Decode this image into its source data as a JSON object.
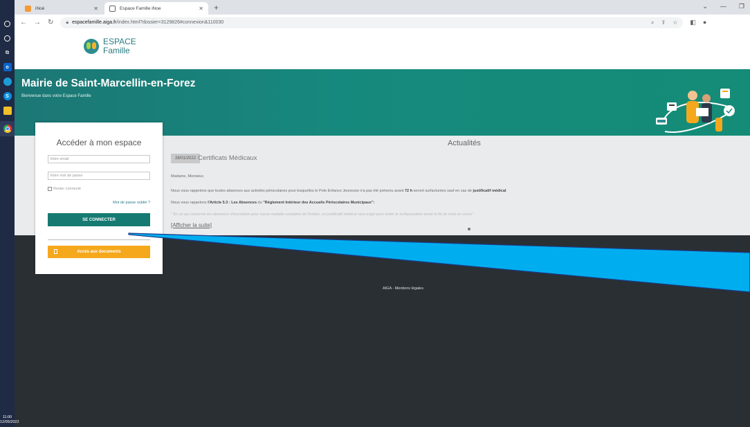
{
  "taskbar": {
    "clock_time": "11:00",
    "clock_date": "12/05/2022"
  },
  "browser": {
    "tabs": [
      {
        "label": "iNoé"
      },
      {
        "label": "Espace Famille iNoe"
      }
    ],
    "url_host": "espacefamille.aiga.fr",
    "url_rest": "/index.html?dossier=3129826#connexion&110030"
  },
  "brand": {
    "line1": "ESPACE",
    "line2": "Famille"
  },
  "hero": {
    "title": "Mairie de Saint-Marcellin-en-Forez",
    "subtitle": "Bienvenue dans votre Espace Famille"
  },
  "login": {
    "title": "Accéder à mon espace",
    "email_placeholder": "Votre email",
    "password_placeholder": "Votre mot de passe",
    "remember_label": "Rester connecté",
    "forgot_label": "Mot de passe oublié ?",
    "connect_label": "SE CONNECTER",
    "documents_label": "Accès aux documents"
  },
  "news": {
    "section_title": "Actualités",
    "date": "28/01/2022",
    "headline": "Certificats Médicaux",
    "greeting": "Madame, Monsieur,",
    "p1_a": "Nous vous rappelons que toutes absences  aux activités périscolaires pour lesquelles le Pole Enfance Jeunesse n'a pas été prévenu avant ",
    "p1_b": "72 h",
    "p1_c": " seront surfacturées sauf en cas de ",
    "p1_d": "justificatif médical",
    "p1_e": ".",
    "p2_a": "Nous vous rappelons ",
    "p2_b": "l'Article 5.3 : Les Absences",
    "p2_c": " du ",
    "p2_d": "\"Règlement Intérieur des Accueils Périscolaires Municipaux\":",
    "p3": "\" En ce qui concerne les absences d'inscription pour cause maladie soudaine de l'enfant, un justificatif médical sera exigé pour éviter la surfacturation avant la fin du mois en cours\".",
    "more_label": "[Afficher la suite]"
  },
  "footer": {
    "text": "AIGA  -  Mentions légales"
  },
  "colors": {
    "teal": "#157a72",
    "orange": "#f6a81c",
    "annotation_arrow": "#00aeef"
  }
}
